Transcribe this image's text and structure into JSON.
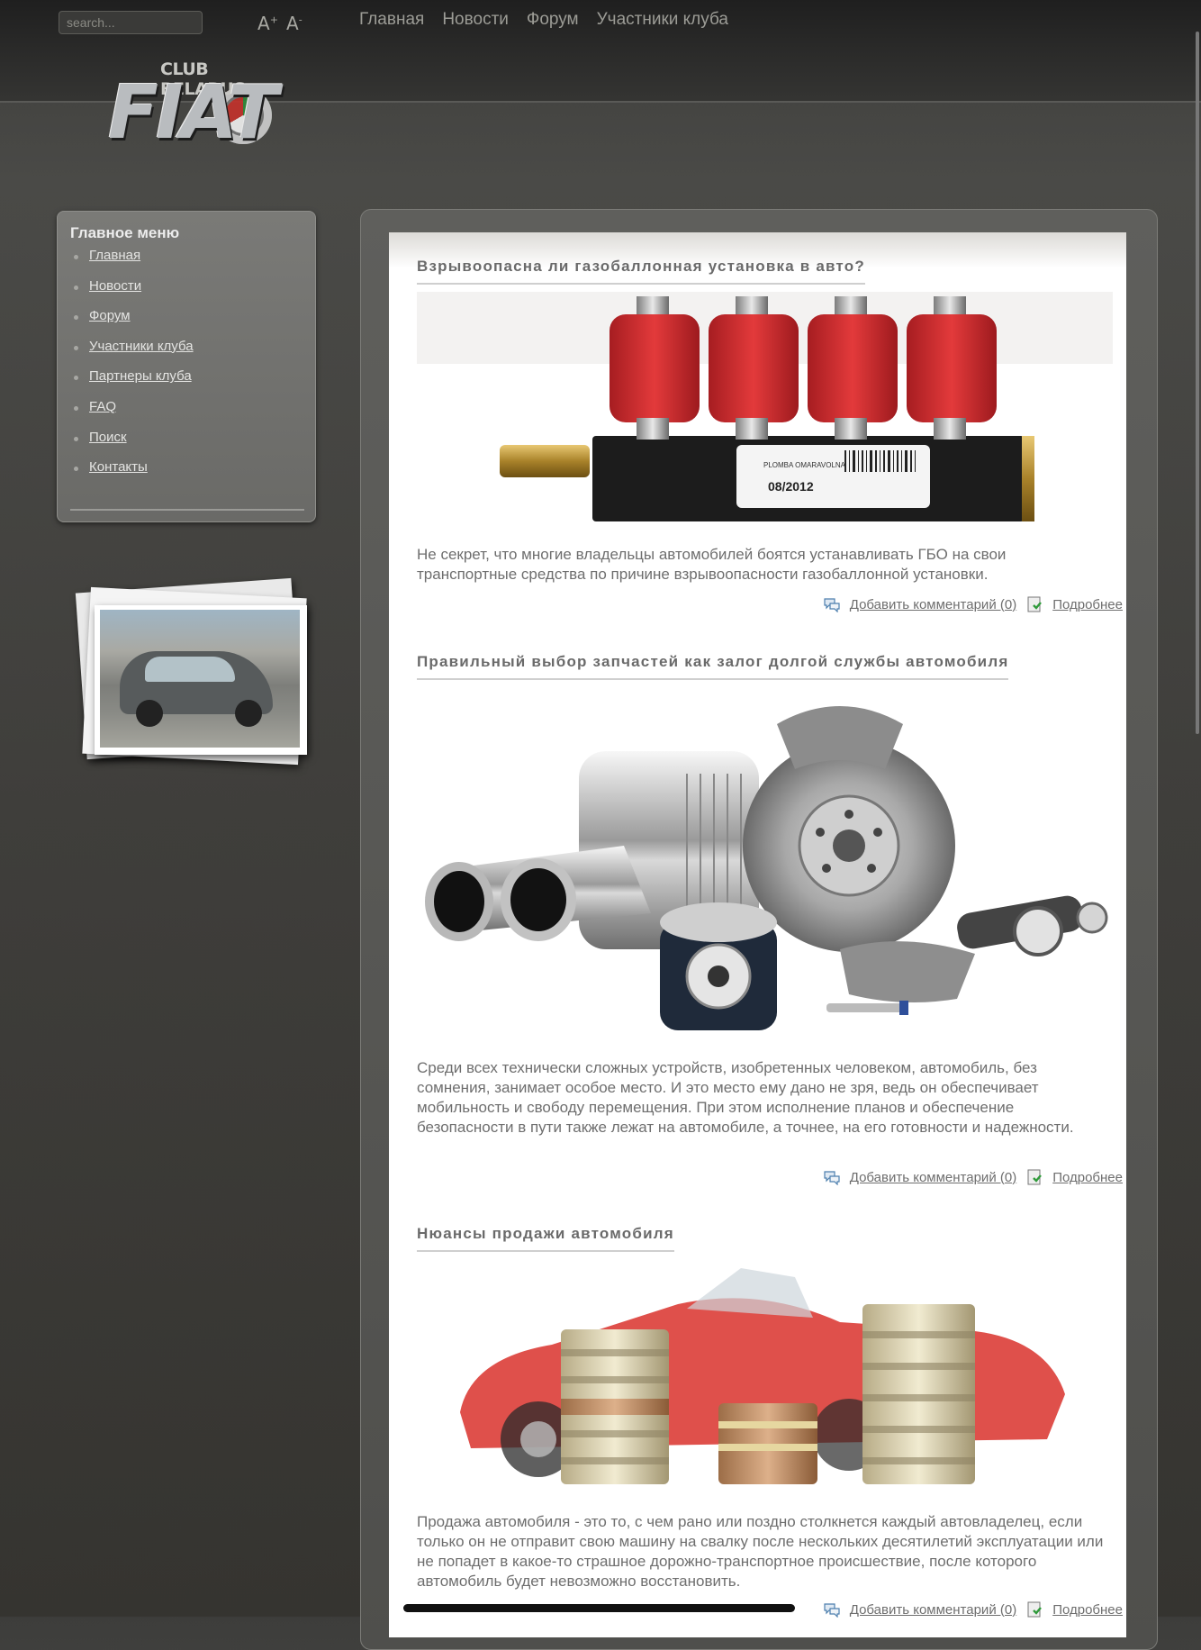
{
  "search": {
    "placeholder": "search..."
  },
  "font_controls": {
    "increase": "A",
    "increase_sup": "+",
    "decrease": "A",
    "decrease_sup": "-"
  },
  "top_nav": [
    "Главная",
    "Новости",
    "Форум",
    "Участники клуба"
  ],
  "logo": {
    "line1": "CLUB BELARUS",
    "line2": "FIAT"
  },
  "sidebar": {
    "title": "Главное меню",
    "items": [
      "Главная",
      "Новости",
      "Форум",
      "Участники клуба",
      "Партнеры клуба",
      "FAQ",
      "Поиск",
      "Контакты"
    ]
  },
  "articles": [
    {
      "title": "Взрывоопасна ли газобаллонная установка в авто?",
      "image_label": "08/2012",
      "image_brand": "PLOMBA OMARAVOLNA",
      "text": "Не секрет, что многие владельцы автомобилей боятся устанавливать ГБО на свои транспортные средства по причине взрывоопасности газобаллонной установки.",
      "comment_link": "Добавить комментарий (0)",
      "more_link": "Подробнее"
    },
    {
      "title": "Правильный выбор запчастей как залог долгой службы автомобиля",
      "text": "Среди всех технически сложных устройств, изобретенных человеком, автомобиль, без сомнения, занимает особое место. И это место ему дано не зря, ведь он обеспечивает мобильность и свободу перемещения. При этом исполнение планов и обеспечение безопасности в пути также лежат на автомобиле, а точнее, на его готовности и надежности.",
      "comment_link": "Добавить комментарий (0)",
      "more_link": "Подробнее"
    },
    {
      "title": "Нюансы продажи автомобиля",
      "text": "Продажа автомобиля - это то, с чем рано или поздно столкнется каждый автовладелец, если только он не отправит свою машину на свалку после нескольких десятилетий эксплуатации или не попадет в какое-то страшное дорожно-транспортное происшествие, после которого автомобиль будет невозможно восстановить.",
      "comment_link": "Добавить комментарий (0)",
      "more_link": "Подробнее"
    }
  ],
  "colors": {
    "page_bg": "#45443f",
    "content_bg": "#ffffff",
    "text": "#6e6e6e",
    "injector_red": "#d62d2f"
  }
}
